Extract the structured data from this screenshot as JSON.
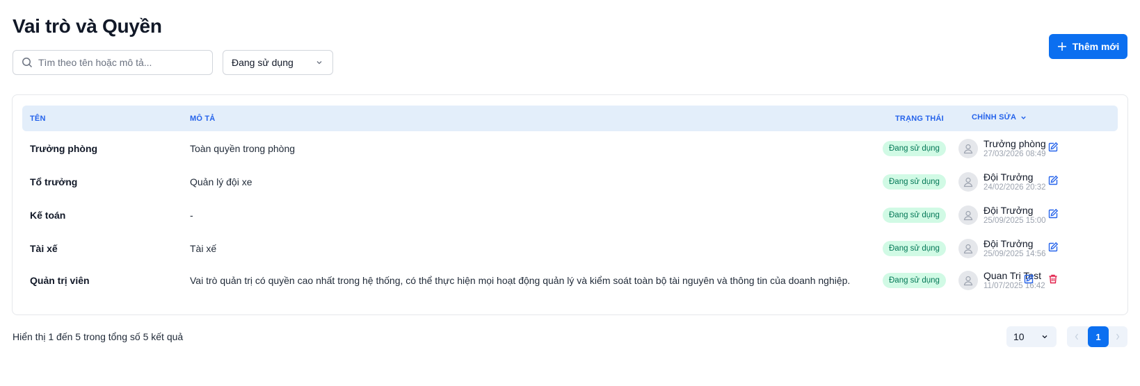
{
  "page": {
    "title": "Vai trò và Quyền"
  },
  "toolbar": {
    "search_placeholder": "Tìm theo tên hoặc mô tả...",
    "search_value": "",
    "status_filter_value": "Đang sử dụng",
    "add_button_label": "Thêm mới"
  },
  "table": {
    "headers": {
      "name": "TÊN",
      "description": "MÔ TẢ",
      "status": "TRẠNG THÁI",
      "edited": "CHỈNH SỬA"
    },
    "rows": [
      {
        "name": "Trưởng phòng",
        "description": "Toàn quyền trong phòng",
        "status": "Đang sử dụng",
        "editor": "Trưởng phòng",
        "edited_at": "27/03/2026 08:49",
        "can_delete": false
      },
      {
        "name": "Tổ trưởng",
        "description": "Quản lý đội xe",
        "status": "Đang sử dụng",
        "editor": "Đội Trưởng",
        "edited_at": "24/02/2026 20:32",
        "can_delete": false
      },
      {
        "name": "Kế toán",
        "description": "-",
        "status": "Đang sử dụng",
        "editor": "Đội Trưởng",
        "edited_at": "25/09/2025 15:00",
        "can_delete": false
      },
      {
        "name": "Tài xế",
        "description": "Tài xế",
        "status": "Đang sử dụng",
        "editor": "Đội Trưởng",
        "edited_at": "25/09/2025 14:56",
        "can_delete": false
      },
      {
        "name": "Quản trị viên",
        "description": "Vai trò quản trị có quyền cao nhất trong hệ thống, có thể thực hiện mọi hoạt động quản lý và kiểm soát toàn bộ tài nguyên và thông tin của doanh nghiệp.",
        "status": "Đang sử dụng",
        "editor": "Quan Trị Test",
        "edited_at": "11/07/2025 16:42",
        "can_delete": true
      }
    ]
  },
  "footer": {
    "summary": "Hiển thị 1 đến 5 trong tổng số 5 kết quả",
    "page_size": "10",
    "current_page": "1"
  },
  "colors": {
    "primary": "#0b6ff0",
    "header_bg": "#e3eefa",
    "header_text": "#2563eb",
    "badge_bg": "#d1fae5",
    "badge_text": "#047857",
    "delete": "#e11d48"
  },
  "icons": [
    "search-icon",
    "chevron-down-icon",
    "plus-icon",
    "user-avatar-icon",
    "edit-icon",
    "trash-icon",
    "chevron-left-icon",
    "chevron-right-icon"
  ]
}
